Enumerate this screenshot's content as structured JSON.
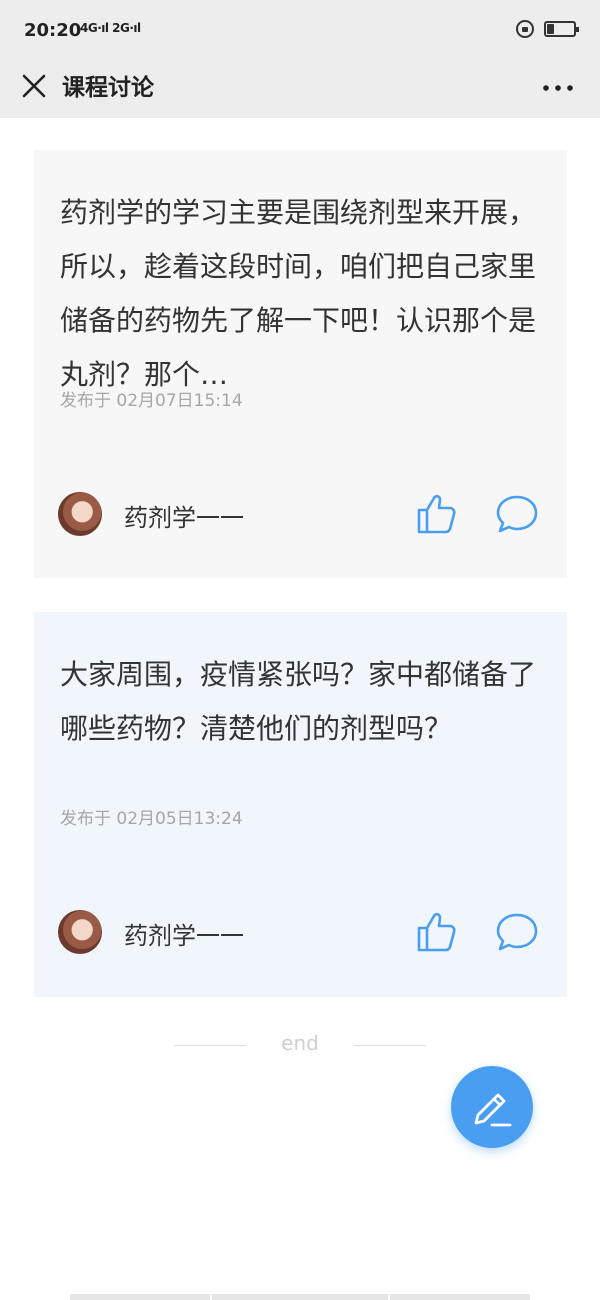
{
  "status_bar": {
    "time": "20:20",
    "signal_text": "4G·ıl 2G·ıl",
    "battery_level": 0.25
  },
  "nav": {
    "close_icon": "close-icon",
    "title": "课程讨论",
    "more_icon": "more-icon"
  },
  "posts": [
    {
      "text": "药剂学的学习主要是围绕剂型来开展，所以，趁着这段时间，咱们把自己家里储备的药物先了解一下吧！认识那个是丸剂？那个…",
      "time": "发布于 02月07日15:14",
      "author": "药剂学一一",
      "background": "#f7f7f7"
    },
    {
      "text": "大家周围，疫情紧张吗？家中都储备了哪些药物？清楚他们的剂型吗？",
      "time": "发布于 02月05日13:24",
      "author": "药剂学一一",
      "background": "#f1f6fc"
    }
  ],
  "end_label": "end",
  "accent_color": "#4a9ef1",
  "fab_icon": "pencil-icon"
}
